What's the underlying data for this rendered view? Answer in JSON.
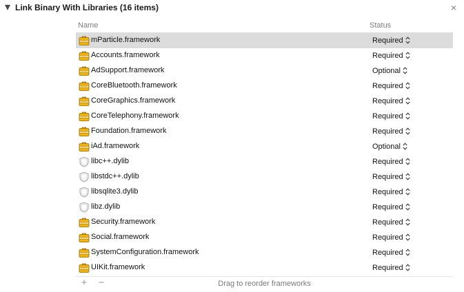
{
  "section": {
    "title": "Link Binary With Libraries (16 items)",
    "close_glyph": "×"
  },
  "columns": {
    "name": "Name",
    "status": "Status"
  },
  "libraries": [
    {
      "name": "mParticle.framework",
      "status": "Required",
      "icon": "framework-toolbox-icon",
      "selected": true
    },
    {
      "name": "Accounts.framework",
      "status": "Required",
      "icon": "framework-toolbox-icon"
    },
    {
      "name": "AdSupport.framework",
      "status": "Optional",
      "icon": "framework-toolbox-icon"
    },
    {
      "name": "CoreBluetooth.framework",
      "status": "Required",
      "icon": "framework-toolbox-icon"
    },
    {
      "name": "CoreGraphics.framework",
      "status": "Required",
      "icon": "framework-toolbox-icon"
    },
    {
      "name": "CoreTelephony.framework",
      "status": "Required",
      "icon": "framework-toolbox-icon"
    },
    {
      "name": "Foundation.framework",
      "status": "Required",
      "icon": "framework-toolbox-icon"
    },
    {
      "name": "iAd.framework",
      "status": "Optional",
      "icon": "framework-toolbox-icon"
    },
    {
      "name": "libc++.dylib",
      "status": "Required",
      "icon": "dylib-shield-icon"
    },
    {
      "name": "libstdc++.dylib",
      "status": "Required",
      "icon": "dylib-shield-icon"
    },
    {
      "name": "libsqlite3.dylib",
      "status": "Required",
      "icon": "dylib-shield-icon"
    },
    {
      "name": "libz.dylib",
      "status": "Required",
      "icon": "dylib-shield-icon"
    },
    {
      "name": "Security.framework",
      "status": "Required",
      "icon": "framework-toolbox-icon"
    },
    {
      "name": "Social.framework",
      "status": "Required",
      "icon": "framework-toolbox-icon"
    },
    {
      "name": "SystemConfiguration.framework",
      "status": "Required",
      "icon": "framework-toolbox-icon"
    },
    {
      "name": "UIKit.framework",
      "status": "Required",
      "icon": "framework-toolbox-icon"
    }
  ],
  "footer": {
    "add_glyph": "+",
    "remove_glyph": "−",
    "hint": "Drag to reorder frameworks"
  },
  "colors": {
    "toolbox_fill": "#f2b40c",
    "toolbox_edge": "#9a6a00",
    "shield_edge": "#a6a6a6",
    "selected_row": "#dcdcdc"
  }
}
